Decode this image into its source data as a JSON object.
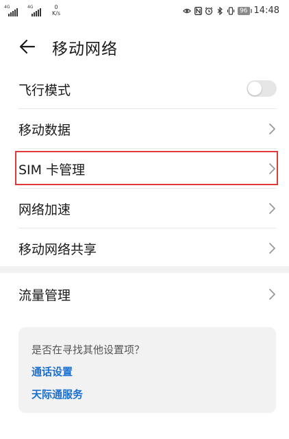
{
  "status_bar": {
    "network_1": "4G",
    "network_2": "4G",
    "speed_value": "0",
    "speed_unit": "K/s",
    "battery": "96",
    "time": "14:48"
  },
  "header": {
    "title": "移动网络"
  },
  "settings": {
    "airplane_mode": {
      "label": "飞行模式",
      "enabled": false
    },
    "mobile_data": {
      "label": "移动数据"
    },
    "sim_management": {
      "label": "SIM 卡管理",
      "highlighted": true,
      "highlight_color": "#e03a3a"
    },
    "network_boost": {
      "label": "网络加速"
    },
    "hotspot_sharing": {
      "label": "移动网络共享"
    },
    "data_usage": {
      "label": "流量管理"
    }
  },
  "suggestions": {
    "question": "是否在寻找其他设置项？",
    "links": [
      "通话设置",
      "天际通服务"
    ]
  },
  "colors": {
    "link": "#1a6fd1",
    "highlight": "#e03a3a"
  }
}
